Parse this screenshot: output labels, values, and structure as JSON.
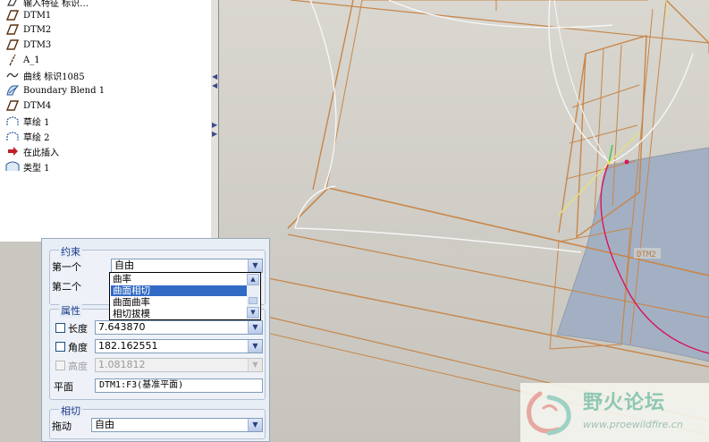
{
  "tree": {
    "items": [
      {
        "label": "输入特征 标识…",
        "icon": "feature-icon"
      },
      {
        "label": "DTM1",
        "icon": "datum-plane-icon"
      },
      {
        "label": "DTM2",
        "icon": "datum-plane-icon"
      },
      {
        "label": "DTM3",
        "icon": "datum-plane-icon"
      },
      {
        "label": "A_1",
        "icon": "datum-axis-icon"
      },
      {
        "label": "曲线 标识1085",
        "icon": "curve-icon"
      },
      {
        "label": "Boundary Blend 1",
        "icon": "boundary-blend-icon"
      },
      {
        "label": "DTM4",
        "icon": "datum-plane-icon"
      },
      {
        "label": "草绘 1",
        "icon": "sketch-icon"
      },
      {
        "label": "草绘 2",
        "icon": "sketch-icon"
      },
      {
        "label": "在此插入",
        "icon": "insert-here-icon"
      },
      {
        "label": "类型 1",
        "icon": "type-feature-icon"
      }
    ]
  },
  "viewport": {
    "datum_label": "DTM2"
  },
  "dialog": {
    "constraints": {
      "title": "约束",
      "first_label": "第一个",
      "first_value": "自由",
      "second_label": "第二个",
      "options": [
        "曲率",
        "曲面相切",
        "曲面曲率",
        "相切拔模"
      ],
      "highlighted": "曲面相切"
    },
    "properties": {
      "title": "属性",
      "length_label": "长度",
      "length_value": "7.643870",
      "angle_label": "角度",
      "angle_value": "182.162551",
      "height_label": "高度",
      "height_value": "1.081812",
      "plane_label": "平面",
      "plane_value": "DTM1:F3(基准平面)"
    },
    "tangent": {
      "title": "相切",
      "drag_label": "拖动",
      "drag_value": "自由"
    }
  },
  "watermark": {
    "title": "野火论坛",
    "url": "www.proewildfire.cn"
  },
  "colors": {
    "highlight": "#316ac5",
    "group_title": "#1a3a8a",
    "edge_orange": "#c8864a",
    "surface_blue": "#a3b0c3"
  }
}
